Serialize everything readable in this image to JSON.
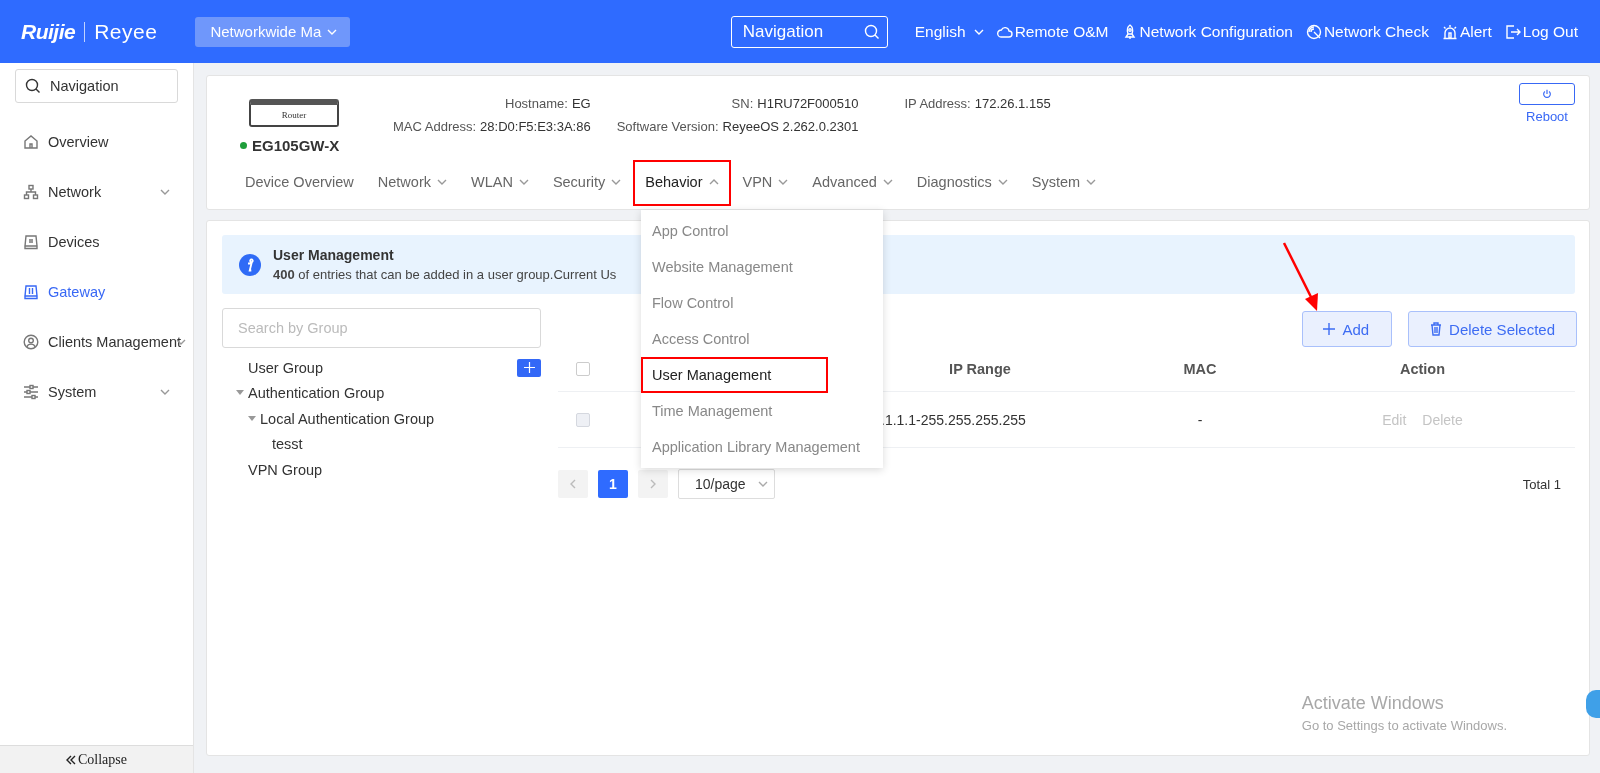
{
  "top_bar": {
    "logo": {
      "brand": "Ruijie",
      "product": "Reyee"
    },
    "scope_selector": "Networkwide Ma",
    "search": {
      "placeholder": "Navigation"
    },
    "language": "English",
    "actions": [
      {
        "label": "Remote O&M"
      },
      {
        "label": "Network Configuration"
      },
      {
        "label": "Network Check"
      },
      {
        "label": "Alert"
      },
      {
        "label": "Log Out"
      }
    ]
  },
  "sidebar": {
    "search": {
      "placeholder": "Navigation"
    },
    "items": [
      {
        "label": "Overview",
        "expandable": false,
        "selected": false
      },
      {
        "label": "Network",
        "expandable": true,
        "selected": false
      },
      {
        "label": "Devices",
        "expandable": false,
        "selected": false
      },
      {
        "label": "Gateway",
        "expandable": false,
        "selected": true
      },
      {
        "label": "Clients Management",
        "expandable": true,
        "selected": false
      },
      {
        "label": "System",
        "expandable": true,
        "selected": false
      }
    ],
    "collapse": "Collapse"
  },
  "device": {
    "image_label": "Router",
    "name": "EG105GW-X",
    "online": true,
    "fields": [
      {
        "label": "Hostname:",
        "value": "EG"
      },
      {
        "label": "SN:",
        "value": "H1RU72F000510"
      },
      {
        "label": "IP Address:",
        "value": "172.26.1.155"
      },
      {
        "label": "MAC Address:",
        "value": "28:D0:F5:E3:3A:86"
      },
      {
        "label": "Software Version:",
        "value": "ReyeeOS 2.262.0.2301"
      }
    ],
    "reboot": "Reboot"
  },
  "tabs": [
    {
      "label": "Device Overview",
      "has_menu": false,
      "selected": false,
      "highlighted": false
    },
    {
      "label": "Network",
      "has_menu": true,
      "selected": false,
      "highlighted": false
    },
    {
      "label": "WLAN",
      "has_menu": true,
      "selected": false,
      "highlighted": false
    },
    {
      "label": "Security",
      "has_menu": true,
      "selected": false,
      "highlighted": false
    },
    {
      "label": "Behavior",
      "has_menu": true,
      "selected": true,
      "highlighted": true
    },
    {
      "label": "VPN",
      "has_menu": true,
      "selected": false,
      "highlighted": false
    },
    {
      "label": "Advanced",
      "has_menu": true,
      "selected": false,
      "highlighted": false
    },
    {
      "label": "Diagnostics",
      "has_menu": true,
      "selected": false,
      "highlighted": false
    },
    {
      "label": "System",
      "has_menu": true,
      "selected": false,
      "highlighted": false
    }
  ],
  "behavior_menu": {
    "items": [
      {
        "label": "App Control",
        "selected": false,
        "highlighted": false
      },
      {
        "label": "Website Management",
        "selected": false,
        "highlighted": false
      },
      {
        "label": "Flow Control",
        "selected": false,
        "highlighted": false
      },
      {
        "label": "Access Control",
        "selected": false,
        "highlighted": false
      },
      {
        "label": "User Management",
        "selected": true,
        "highlighted": true
      },
      {
        "label": "Time Management",
        "selected": false,
        "highlighted": false
      },
      {
        "label": "Application Library Management",
        "selected": false,
        "highlighted": false
      }
    ]
  },
  "notice": {
    "title": "User Management",
    "text": "**400** of entries that can be added in a user group.Current Us"
  },
  "group_panel": {
    "search": {
      "placeholder": "Search by Group"
    },
    "tree": [
      {
        "label": "User Group",
        "has_add_button": true
      },
      {
        "label": "Authentication Group",
        "has_add_button": false,
        "expanded": true,
        "children": [
          {
            "label": "Local Authentication Group",
            "has_add_button": false,
            "expanded": true,
            "children": [
              {
                "label": "tesst",
                "has_add_button": false
              }
            ]
          }
        ]
      },
      {
        "label": "VPN Group",
        "has_add_button": false
      }
    ]
  },
  "toolbar": {
    "buttons": [
      {
        "label": "Add"
      },
      {
        "label": "Delete Selected"
      }
    ]
  },
  "table": {
    "header_checked": false,
    "columns": [
      {
        "label": "IP Range"
      },
      {
        "label": "MAC"
      },
      {
        "label": "Action"
      }
    ],
    "rows": [
      {
        "checked": false,
        "disabled": true,
        "ip_range": ".1.1.1-255.255.255.255",
        "mac": "-",
        "actions": [
          {
            "label": "Edit",
            "disabled": true
          },
          {
            "label": "Delete",
            "disabled": true
          }
        ]
      }
    ]
  },
  "pagination": {
    "pages": [
      {
        "label": "1",
        "selected": true
      }
    ],
    "page_size": "10/page",
    "total": "Total 1"
  },
  "os_notice": {
    "title": "Activate Windows",
    "text": "Go to Settings to activate Windows."
  }
}
